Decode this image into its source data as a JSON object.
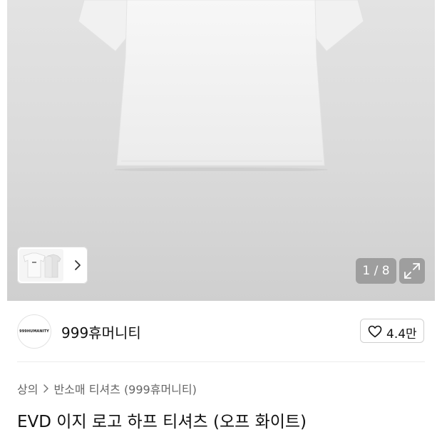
{
  "gallery": {
    "counter": "1 / 8",
    "icons": {
      "next": "chevron-right-icon",
      "expand": "expand-arrows-icon"
    }
  },
  "brand": {
    "logo_text": "999HUMANITY",
    "name": "999휴머니티",
    "like_count": "4.4만",
    "like_icon": "heart-outline-icon"
  },
  "breadcrumb": {
    "items": [
      "상의",
      "반소매 티셔츠 (999휴머니티)"
    ],
    "separator_icon": "chevron-right-icon"
  },
  "product": {
    "title": "EVD 이지 로고 하프 티셔츠 (오프 화이트)"
  },
  "colors": {
    "hero_bg": "#dadada",
    "overlay_button": "#8c8c8c"
  }
}
